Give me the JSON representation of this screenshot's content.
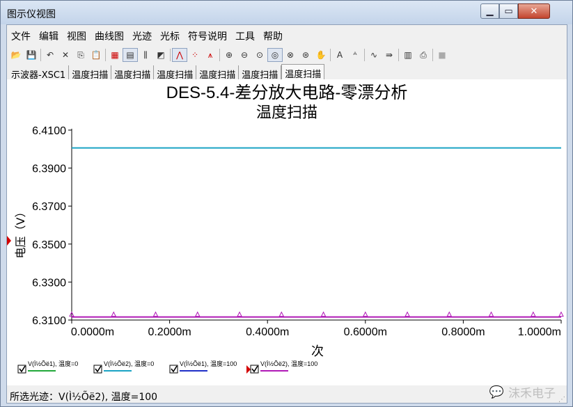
{
  "window": {
    "title": "图示仪视图"
  },
  "menu": [
    "文件",
    "编辑",
    "视图",
    "曲线图",
    "光迹",
    "光标",
    "符号说明",
    "工具",
    "帮助"
  ],
  "toolbar": [
    {
      "icon": "open-folder-icon",
      "glyph": "📂"
    },
    {
      "icon": "save-icon",
      "glyph": "💾"
    },
    {
      "sep": true
    },
    {
      "icon": "undo-icon",
      "glyph": "↶"
    },
    {
      "icon": "cut-icon",
      "glyph": "✕"
    },
    {
      "icon": "copy-icon",
      "glyph": "⎘"
    },
    {
      "icon": "paste-icon",
      "glyph": "📋"
    },
    {
      "sep": true
    },
    {
      "icon": "grid-icon",
      "glyph": "▦"
    },
    {
      "icon": "legend-icon",
      "glyph": "▤",
      "pressed": true
    },
    {
      "icon": "selected-marks-icon",
      "glyph": "⫼"
    },
    {
      "icon": "overlay-icon",
      "glyph": "◩"
    },
    {
      "sep": true
    },
    {
      "icon": "show-line-icon",
      "glyph": "⋀",
      "pressed": true
    },
    {
      "icon": "show-markers-icon",
      "glyph": "⁘"
    },
    {
      "icon": "show-line-markers-icon",
      "glyph": "⩚"
    },
    {
      "sep": true
    },
    {
      "icon": "zoom-in-icon",
      "glyph": "⊕"
    },
    {
      "icon": "zoom-out-icon",
      "glyph": "⊖"
    },
    {
      "icon": "zoom-fit-icon",
      "glyph": "⊙"
    },
    {
      "icon": "zoom-area-icon",
      "glyph": "◎",
      "pressed": true
    },
    {
      "icon": "zoom-x-icon",
      "glyph": "⊗"
    },
    {
      "icon": "zoom-y-icon",
      "glyph": "⊛"
    },
    {
      "icon": "pan-hand-icon",
      "glyph": "✋"
    },
    {
      "sep": true
    },
    {
      "icon": "text-icon",
      "glyph": "A"
    },
    {
      "icon": "label-icon",
      "glyph": "ᴬ"
    },
    {
      "sep": true
    },
    {
      "icon": "trace-icon",
      "glyph": "∿"
    },
    {
      "icon": "export-icon",
      "glyph": "⇛"
    },
    {
      "sep": true
    },
    {
      "icon": "print-preview-icon",
      "glyph": "▥"
    },
    {
      "icon": "print-icon",
      "glyph": "⎙"
    },
    {
      "sep": true
    },
    {
      "icon": "stop-icon",
      "glyph": "■"
    }
  ],
  "tabs": [
    {
      "label": "示波器-XSC1",
      "active": false
    },
    {
      "label": "温度扫描",
      "active": false
    },
    {
      "label": "温度扫描",
      "active": false
    },
    {
      "label": "温度扫描",
      "active": false
    },
    {
      "label": "温度扫描",
      "active": false
    },
    {
      "label": "温度扫描",
      "active": false
    },
    {
      "label": "温度扫描",
      "active": true
    }
  ],
  "status": {
    "selected_trace": "所选光迹：V(Ì½Õë2), 温度=100"
  },
  "watermark": "沫禾电子",
  "chart_data": {
    "type": "line",
    "title": "DES-5.4-差分放大电路-零漂分析",
    "subtitle": "温度扫描",
    "xlabel": "次",
    "ylabel": "电压（V）",
    "xlim": [
      0,
      1.0
    ],
    "ylim": [
      6.31,
      6.41
    ],
    "xticks": [
      {
        "v": 0.0,
        "label": "0.0000m"
      },
      {
        "v": 0.2,
        "label": "0.2000m"
      },
      {
        "v": 0.4,
        "label": "0.4000m"
      },
      {
        "v": 0.6,
        "label": "0.6000m"
      },
      {
        "v": 0.8,
        "label": "0.8000m"
      },
      {
        "v": 1.0,
        "label": "1.0000m"
      }
    ],
    "yticks": [
      {
        "v": 6.41,
        "label": "6.4100"
      },
      {
        "v": 6.39,
        "label": "6.3900"
      },
      {
        "v": 6.37,
        "label": "6.3700"
      },
      {
        "v": 6.35,
        "label": "6.3500"
      },
      {
        "v": 6.33,
        "label": "6.3300"
      },
      {
        "v": 6.31,
        "label": "6.3100"
      }
    ],
    "grid": false,
    "legend_position": "bottom",
    "series": [
      {
        "name": "V(Ì½Õë1), 温度=0",
        "color": "#22a83a",
        "x": [
          0,
          1.0
        ],
        "y": [
          6.4006,
          6.4006
        ],
        "markers": false,
        "visible": false
      },
      {
        "name": "V(Ì½Õë2), 温度=0",
        "color": "#1aa3c4",
        "x": [
          0,
          1.0
        ],
        "y": [
          6.4006,
          6.4006
        ],
        "markers": false,
        "visible": true
      },
      {
        "name": "V(Ì½Õë1), 温度=100",
        "color": "#1f2fc8",
        "x": [
          0,
          1.0
        ],
        "y": [
          6.3116,
          6.3116
        ],
        "markers": false,
        "visible": false
      },
      {
        "name": "V(Ì½Õë2), 温度=100",
        "color": "#b019b6",
        "x": [
          0,
          0.0857,
          0.1714,
          0.2571,
          0.3429,
          0.4286,
          0.5143,
          0.6,
          0.6857,
          0.7714,
          0.8571,
          0.9429,
          1.0
        ],
        "y": [
          6.3116,
          6.3116,
          6.3116,
          6.3116,
          6.3116,
          6.3116,
          6.3116,
          6.3116,
          6.3116,
          6.3116,
          6.3116,
          6.3116,
          6.3116
        ],
        "markers": true,
        "visible": true,
        "selected": true
      }
    ]
  }
}
